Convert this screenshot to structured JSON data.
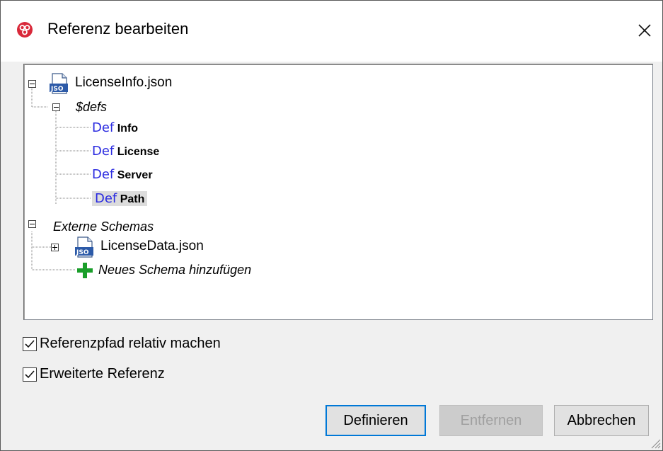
{
  "dialog": {
    "title": "Referenz bearbeiten",
    "close_glyph": "✕"
  },
  "tree": {
    "root": {
      "label": "LicenseInfo.json",
      "icon": "json-file-icon",
      "expanded": true
    },
    "defs_group": {
      "label": "$defs",
      "expanded": true
    },
    "defs": [
      {
        "keyword": "Def",
        "name": "Info",
        "selected": false
      },
      {
        "keyword": "Def",
        "name": "License",
        "selected": false
      },
      {
        "keyword": "Def",
        "name": "Server",
        "selected": false
      },
      {
        "keyword": "Def",
        "name": "Path",
        "selected": true
      }
    ],
    "external": {
      "label": "Externe Schemas",
      "expanded": true
    },
    "external_items": [
      {
        "label": "LicenseData.json",
        "icon": "json-file-icon",
        "expanded": false
      }
    ],
    "add_schema": {
      "label": "Neues Schema hinzufügen",
      "icon": "green-plus-icon"
    }
  },
  "options": {
    "relative_path": {
      "label": "Referenzpfad relativ machen",
      "checked": true
    },
    "extended_ref": {
      "label": "Erweiterte Referenz",
      "checked": true
    }
  },
  "buttons": {
    "define": "Definieren",
    "remove": "Entfernen",
    "cancel": "Abbrechen"
  },
  "colors": {
    "def_keyword": "#2a2ae0",
    "default_button_border": "#0078d7",
    "app_icon_red": "#d9293a",
    "plus_green": "#1a9e2a",
    "selection": "#dcdcdc"
  }
}
